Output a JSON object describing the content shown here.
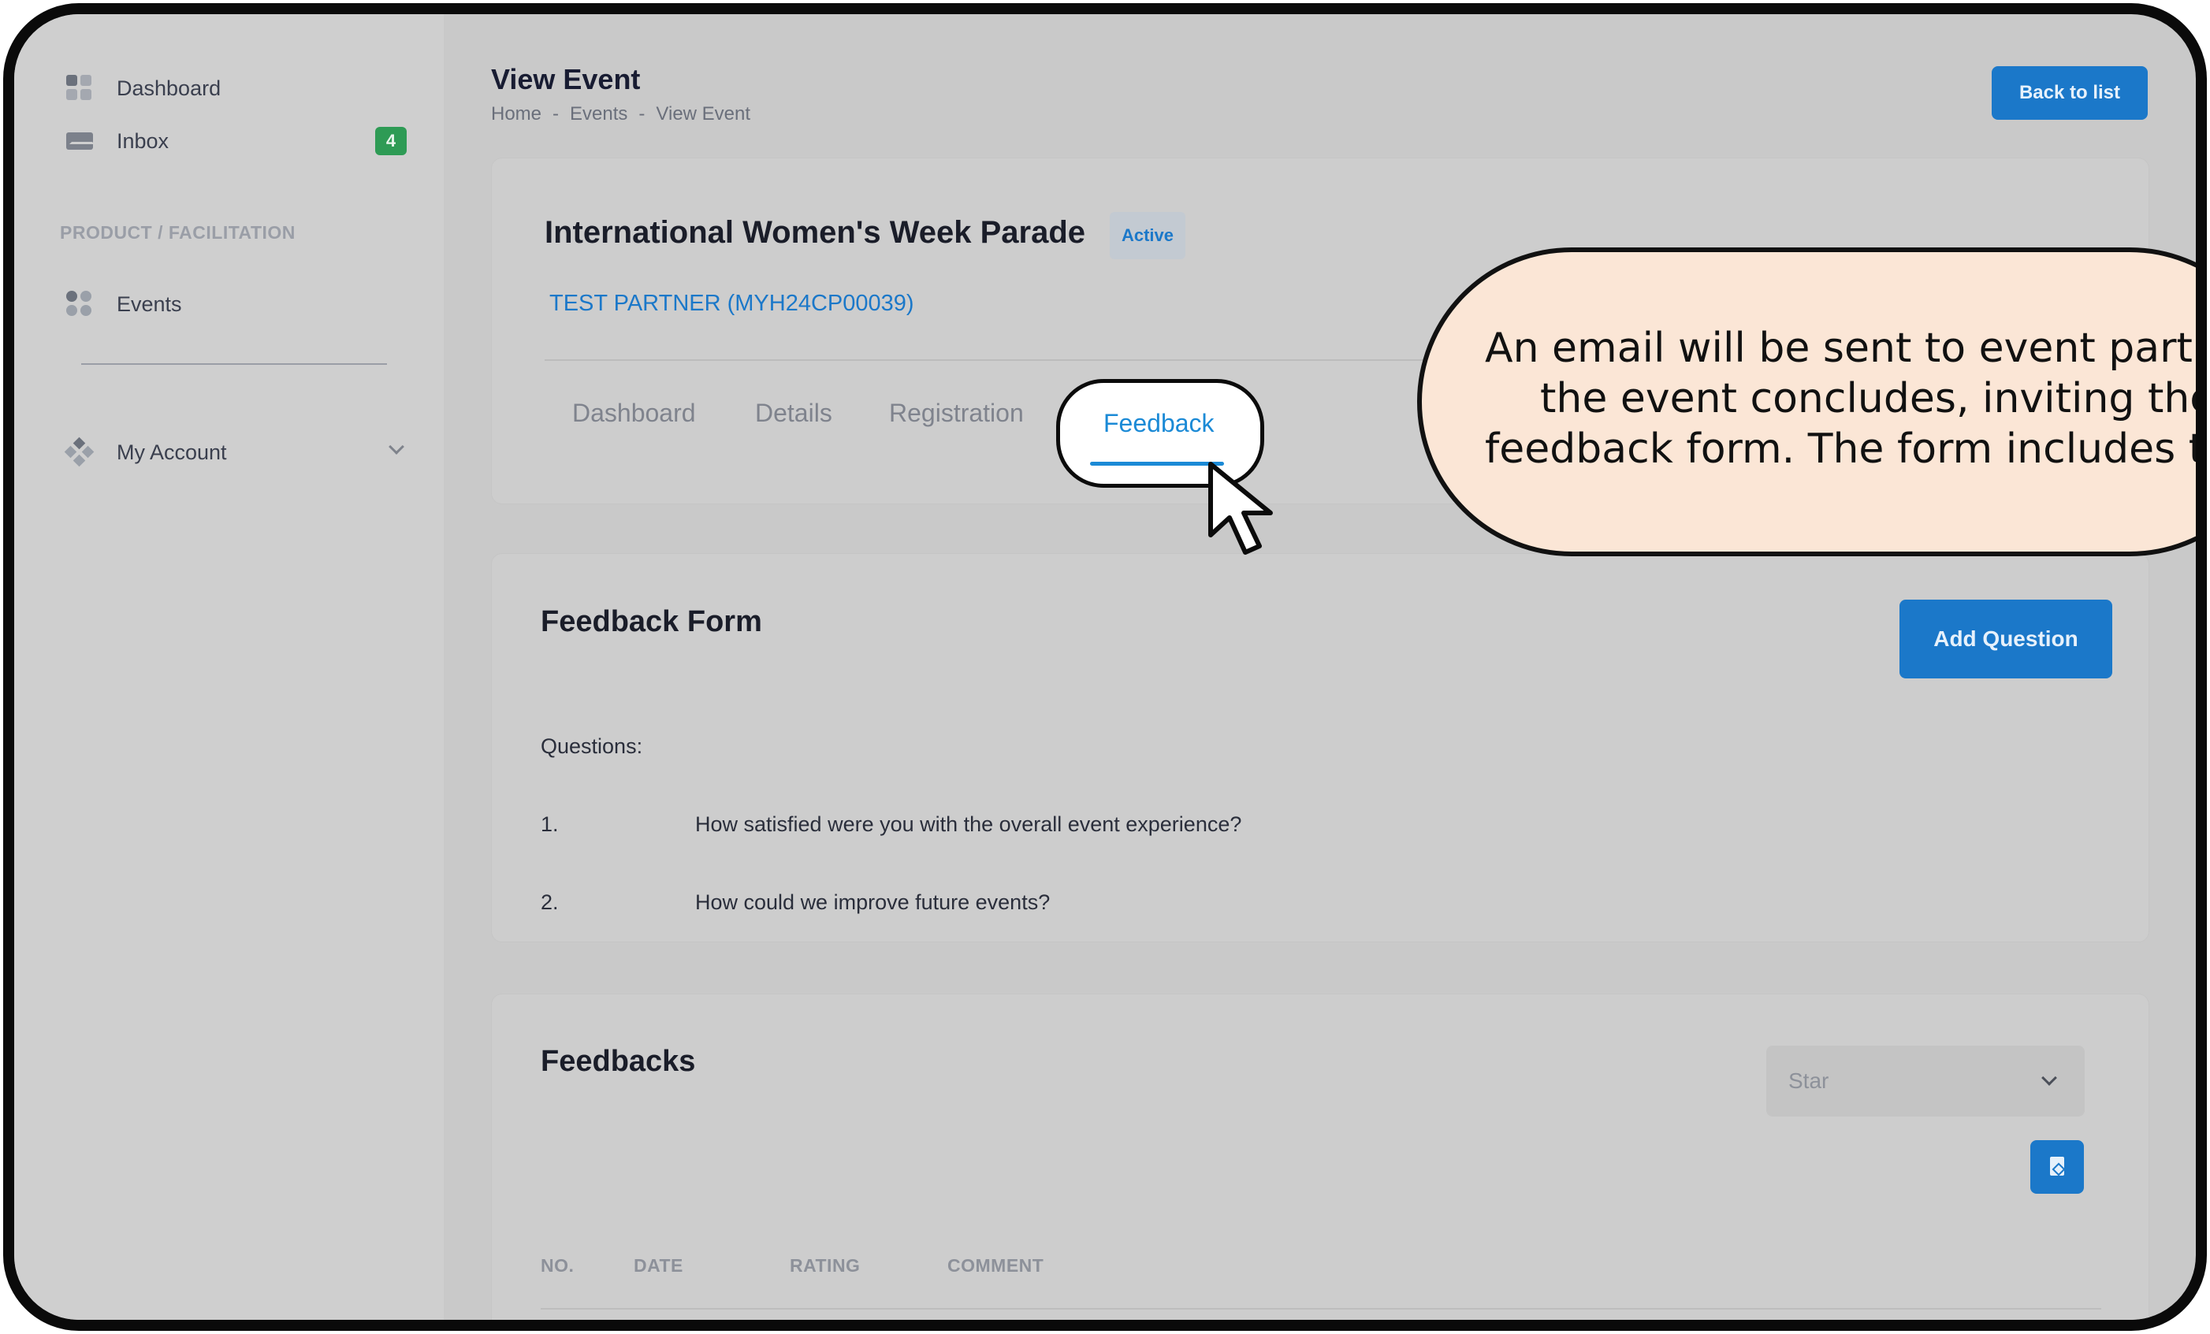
{
  "sidebar": {
    "items": [
      {
        "label": "Dashboard",
        "icon": "dashboard-icon"
      },
      {
        "label": "Inbox",
        "icon": "mail-icon",
        "badge": "4"
      },
      {
        "label": "Events",
        "icon": "events-icon"
      },
      {
        "label": "My Account",
        "icon": "account-icon"
      }
    ],
    "section_label": "PRODUCT / FACILITATION"
  },
  "header": {
    "title": "View Event",
    "breadcrumb": [
      "Home",
      "-",
      "Events",
      "-",
      "View Event"
    ],
    "back_label": "Back to list"
  },
  "event": {
    "name": "International Women's Week Parade",
    "status": "Active",
    "partner": "TEST PARTNER (MYH24CP00039)",
    "tabs": [
      "Dashboard",
      "Details",
      "Registration",
      "Feedback"
    ],
    "active_tab": "Feedback"
  },
  "feedback_form": {
    "title": "Feedback Form",
    "add_label": "Add Question",
    "questions_label": "Questions:",
    "questions": [
      {
        "num": "1.",
        "text": "How satisfied were you with the overall event experience?"
      },
      {
        "num": "2.",
        "text": "How could we improve future events?"
      }
    ]
  },
  "feedbacks": {
    "title": "Feedbacks",
    "filter_value": "Star",
    "columns": [
      "NO.",
      "DATE",
      "RATING",
      "COMMENT"
    ]
  },
  "callout": {
    "lines": [
      "An email will be sent to event partic",
      "the event concludes, inviting ther",
      "feedback form. The form includes tw"
    ]
  },
  "colors": {
    "accent": "#1b78c9",
    "badge_green": "#2e9b55",
    "callout_bg": "#fbe6d6"
  }
}
